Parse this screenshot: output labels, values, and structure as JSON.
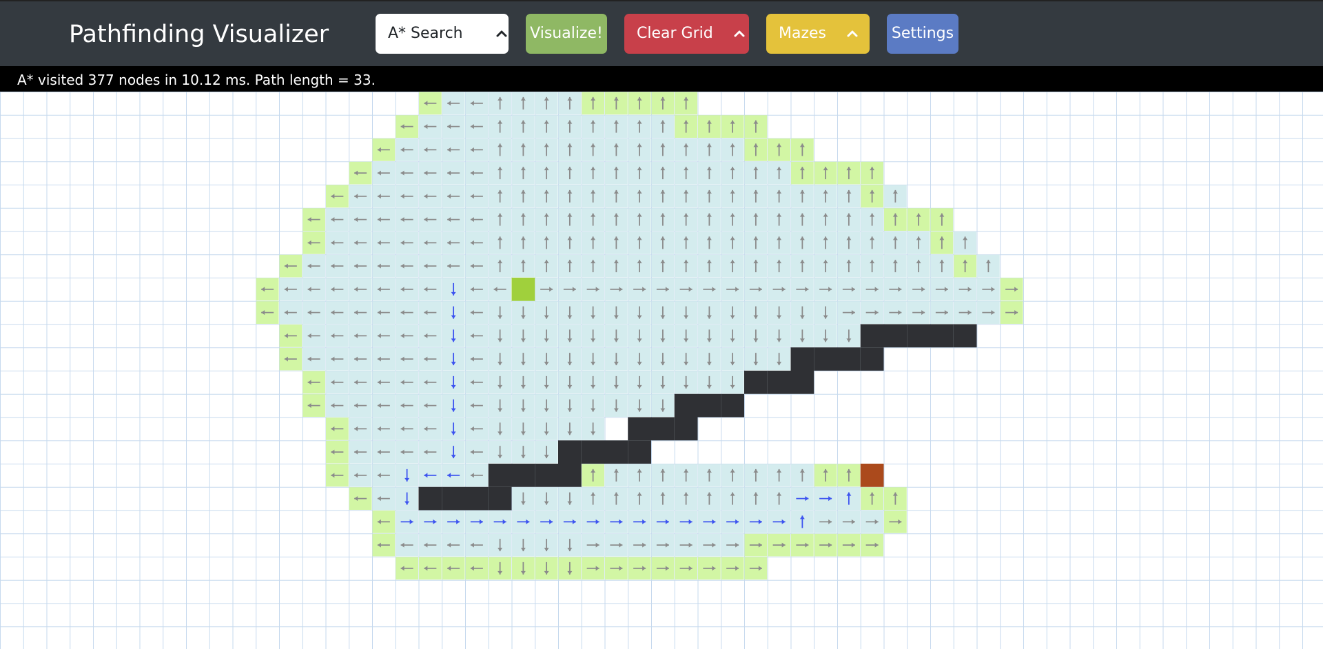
{
  "app": {
    "title": "Pathfinding Visualizer"
  },
  "toolbar": {
    "algorithm_label": "A* Search",
    "visualize_label": "Visualize!",
    "clear_grid_label": "Clear Grid",
    "mazes_label": "Mazes",
    "settings_label": "Settings"
  },
  "status": {
    "message": "A* visited 377 nodes in 10.12 ms. Path length = 33."
  },
  "colors": {
    "navbar": "#343a40",
    "visited": "#d4ecee",
    "frontier": "#d2f6a4",
    "wall": "#2f3034",
    "start": "#a0d03c",
    "target": "#ab4a1c",
    "arrow": "#8b8b8b",
    "path": "#3d54f0",
    "gridline": "#c6d9ee"
  },
  "grid": {
    "start": [
      22,
      8
    ],
    "target": [
      37,
      16
    ]
  }
}
